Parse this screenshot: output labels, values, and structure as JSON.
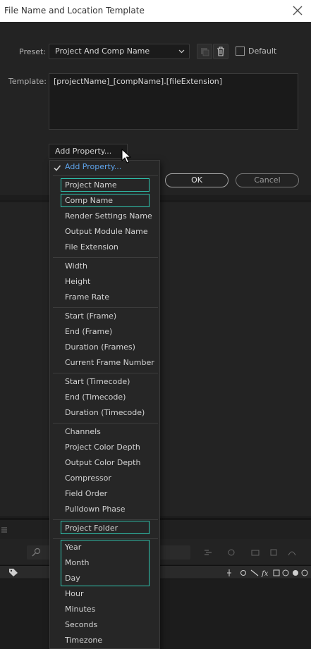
{
  "window": {
    "title": "File Name and Location Template"
  },
  "preset": {
    "label": "Preset:",
    "value": "Project And Comp Name",
    "default_label": "Default",
    "default_checked": false
  },
  "template": {
    "label": "Template:",
    "value": "[projectName]_[compName].[fileExtension]"
  },
  "add_property": {
    "button_label": "Add Property..."
  },
  "buttons": {
    "ok": "OK",
    "cancel": "Cancel"
  },
  "menu": {
    "selected": "Add Property...",
    "groups": [
      {
        "items": [
          "Project Name",
          "Comp Name",
          "Render Settings Name",
          "Output Module Name",
          "File Extension"
        ]
      },
      {
        "items": [
          "Width",
          "Height",
          "Frame Rate"
        ]
      },
      {
        "items": [
          "Start (Frame)",
          "End (Frame)",
          "Duration (Frames)",
          "Current Frame Number"
        ]
      },
      {
        "items": [
          "Start (Timecode)",
          "End (Timecode)",
          "Duration (Timecode)"
        ]
      },
      {
        "items": [
          "Channels",
          "Project Color Depth",
          "Output Color Depth",
          "Compressor",
          "Field Order",
          "Pulldown Phase"
        ]
      },
      {
        "items": [
          "Project Folder"
        ]
      },
      {
        "items": [
          "Year",
          "Month",
          "Day",
          "Hour",
          "Minutes",
          "Seconds",
          "Timezone"
        ]
      }
    ],
    "highlight_color": "#2fc6b0"
  },
  "colors": {
    "accent": "#5ea2e8",
    "highlight": "#2fc6b0",
    "background": "#232323"
  }
}
